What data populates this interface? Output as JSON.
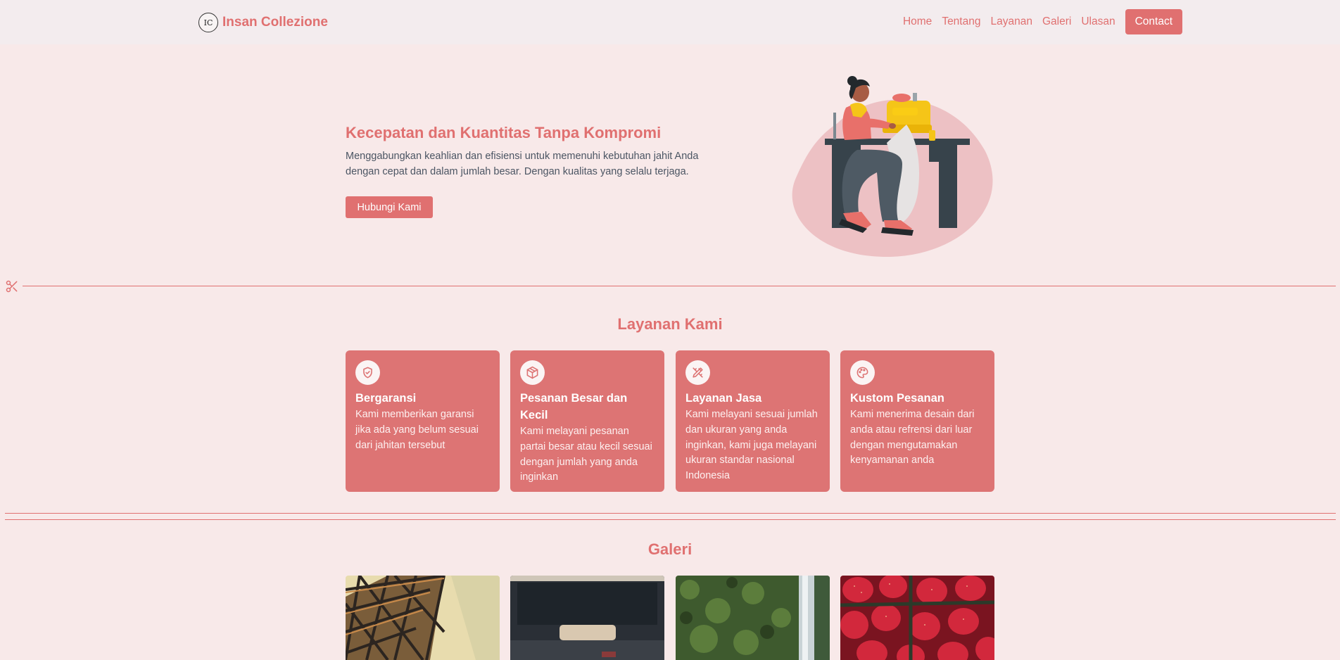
{
  "nav": {
    "logo_text": "IC",
    "brand": "Insan Collezione",
    "links": [
      "Home",
      "Tentang",
      "Layanan",
      "Galeri",
      "Ulasan"
    ],
    "contact": "Contact"
  },
  "hero": {
    "title": "Kecepatan dan Kuantitas Tanpa Kompromi",
    "description": "Menggabungkan keahlian dan efisiensi untuk memenuhi kebutuhan jahit Anda dengan cepat dan dalam jumlah besar. Dengan kualitas yang selalu terjaga.",
    "button": "Hubungi Kami",
    "illustration": "woman-sewing-machine-illustration"
  },
  "services": {
    "title": "Layanan Kami",
    "items": [
      {
        "icon": "shield-check-icon",
        "title": "Bergaransi",
        "desc": "Kami memberikan garansi jika ada yang belum sesuai dari jahitan tersebut"
      },
      {
        "icon": "box-icon",
        "title": "Pesanan Besar dan Kecil",
        "desc": "Kami melayani pesanan partai besar atau kecil sesuai dengan jumlah yang anda inginkan"
      },
      {
        "icon": "ruler-pencil-icon",
        "title": "Layanan Jasa",
        "desc": "Kami melayani sesuai jumlah dan ukuran yang anda inginkan, kami juga melayani ukuran standar nasional Indonesia"
      },
      {
        "icon": "palette-icon",
        "title": "Kustom Pesanan",
        "desc": "Kami menerima desain dari anda atau refrensi dari luar dengan mengutamakan kenyamanan anda"
      }
    ]
  },
  "gallery": {
    "title": "Galeri",
    "images": [
      "steel-structure-photo",
      "car-interior-photo",
      "waterfall-photo",
      "strawberries-photo"
    ]
  },
  "colors": {
    "accent": "#e07070",
    "background": "#f8e9e9",
    "navbar": "#f3ecee",
    "card": "#dd7474"
  }
}
